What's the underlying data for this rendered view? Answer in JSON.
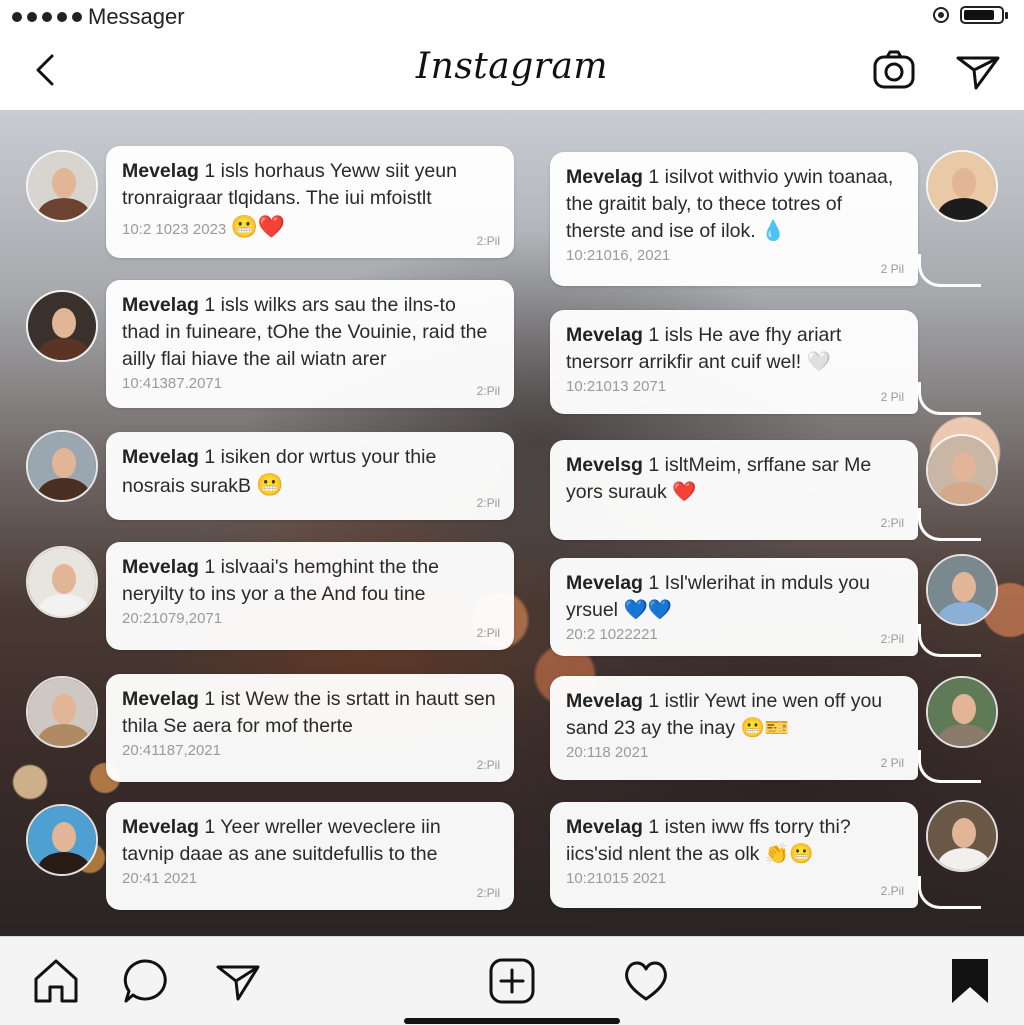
{
  "status_bar": {
    "carrier": "Messager"
  },
  "header": {
    "title": "Instagram"
  },
  "colors": {
    "bubble": "#ffffff",
    "text": "#2a2a2a",
    "heart": "#e02424",
    "blue_heart": "#1e6fe0",
    "emoji": "#f5c842"
  },
  "left_messages": [
    {
      "sender": "Mevelag",
      "text": "1 isls horhaus Yeww siit yeun tronraigraar tlqidans. The iui mfoistlt",
      "date": "10:2 1023 2023",
      "time": "2:Pil",
      "emoji": "😬❤️"
    },
    {
      "sender": "Mevelag",
      "text": "1 isls wilks ars sau the ilns-to thad in fuineare, tOhe the Vouinie, raid the ailly flai hiave the ail wiatn arer",
      "date": "10:41387.2071",
      "time": "2:Pil",
      "emoji": ""
    },
    {
      "sender": "Mevelag",
      "text": "1 isiken dor wrtus your thie nosrais surakB",
      "date": "",
      "time": "2:Pil",
      "emoji": "😬"
    },
    {
      "sender": "Mevelag",
      "text": "1 islvaai's hemghint the the neryilty to ins yor a the And fou tine",
      "date": "20:21079,2071",
      "time": "2:Pil",
      "emoji": ""
    },
    {
      "sender": "Mevelag",
      "text": "1 ist Wew the is srtatt in hautt sen thila Se aera for mof therte",
      "date": "20:41187,2021",
      "time": "2:Pil",
      "emoji": ""
    },
    {
      "sender": "Mevelag",
      "text": "1 Yeer wreller weveclere iin tavnip daae as ane suitdefullis to the",
      "date": "20:41 2021",
      "time": "2:Pil",
      "emoji": ""
    }
  ],
  "right_messages": [
    {
      "sender": "Mevelag",
      "text": "1 isilvot withvio ywin toanaa, the graitit baly, to thece totres of therste and ise of ilok.",
      "date": "10:21016, 2021",
      "time": "2 Pil",
      "emoji": "💧"
    },
    {
      "sender": "Mevelag",
      "text": "1 isls He ave fhy ariart tnersorr arrikfir ant cuif wel!",
      "date": "10:21013 2071",
      "time": "2 Pil",
      "emoji": "🤍"
    },
    {
      "sender": "Mevelsg",
      "text": "1 isltMeim, srffane sar Me yors surauk",
      "date": "",
      "time": "2:Pil",
      "emoji": "❤️"
    },
    {
      "sender": "Mevelag",
      "text": "1 Isl'wlerihat in mduls you yrsuel",
      "date": "20:2 1022221",
      "time": "2:Pil",
      "emoji": "💙💙"
    },
    {
      "sender": "Mevelag",
      "text": "1 istlir Yewt ine wen off you sand 23 ay the inay",
      "date": "20:118 2021",
      "time": "2 Pil",
      "emoji": "😬🎫"
    },
    {
      "sender": "Mevelag",
      "text": "1 isten iww ffs torry thi? iics'sid nlent the as olk",
      "date": "10:21015 2021",
      "time": "2.Pil",
      "emoji": "👏😬"
    }
  ]
}
